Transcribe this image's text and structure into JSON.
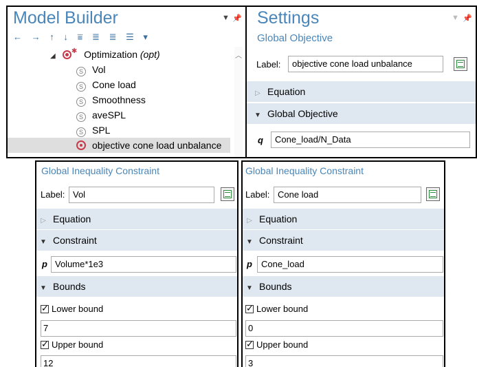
{
  "model_builder": {
    "title": "Model Builder",
    "toolbar_icons": [
      "arrow-left-icon",
      "arrow-right-icon",
      "arrow-up-icon",
      "arrow-down-icon",
      "filter-icon",
      "expand-icon",
      "collapse-icon",
      "list-icon",
      "dropdown-icon"
    ],
    "tree": {
      "parent_label": "Optimization",
      "parent_tag": "(opt)",
      "items": [
        {
          "label": "Vol",
          "icon": "s-icon"
        },
        {
          "label": "Cone load",
          "icon": "s-icon"
        },
        {
          "label": "Smoothness",
          "icon": "s-icon"
        },
        {
          "label": "aveSPL",
          "icon": "s-icon"
        },
        {
          "label": "SPL",
          "icon": "s-icon"
        },
        {
          "label": "objective cone load unbalance",
          "icon": "objective-icon",
          "selected": true
        }
      ]
    }
  },
  "settings": {
    "title": "Settings",
    "subtitle": "Global Objective",
    "label_caption": "Label:",
    "label_value": "objective cone load unbalance",
    "sections": [
      "Equation",
      "Global Objective"
    ],
    "var_name": "q",
    "expression": "Cone_load/N_Data"
  },
  "constraints": [
    {
      "title": "Global Inequality Constraint",
      "label_caption": "Label:",
      "label_value": "Vol",
      "section_equation": "Equation",
      "section_constraint": "Constraint",
      "var_name": "p",
      "expression": "Volume*1e3",
      "section_bounds": "Bounds",
      "lower_label": "Lower bound",
      "lower_value": "7",
      "upper_label": "Upper bound",
      "upper_value": "12"
    },
    {
      "title": "Global Inequality Constraint",
      "label_caption": "Label:",
      "label_value": "Cone load",
      "section_equation": "Equation",
      "section_constraint": "Constraint",
      "var_name": "p",
      "expression": "Cone_load",
      "section_bounds": "Bounds",
      "lower_label": "Lower bound",
      "lower_value": "0",
      "upper_label": "Upper bound",
      "upper_value": "3"
    }
  ],
  "colors": {
    "accent": "#4a86b8",
    "section_bg": "#dfe8f1",
    "selection": "#dedede",
    "optimization_icon": "#c63a4a"
  }
}
